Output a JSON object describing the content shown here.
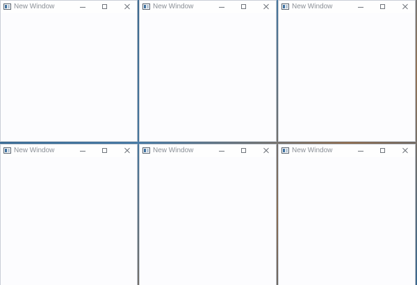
{
  "windows": [
    {
      "title": "New Window"
    },
    {
      "title": "New Window"
    },
    {
      "title": "New Window"
    },
    {
      "title": "New Window"
    },
    {
      "title": "New Window"
    },
    {
      "title": "New Window"
    }
  ],
  "icons": {
    "app": "app-window-icon",
    "minimize": "minimize-icon",
    "maximize": "maximize-icon",
    "close": "close-icon"
  }
}
